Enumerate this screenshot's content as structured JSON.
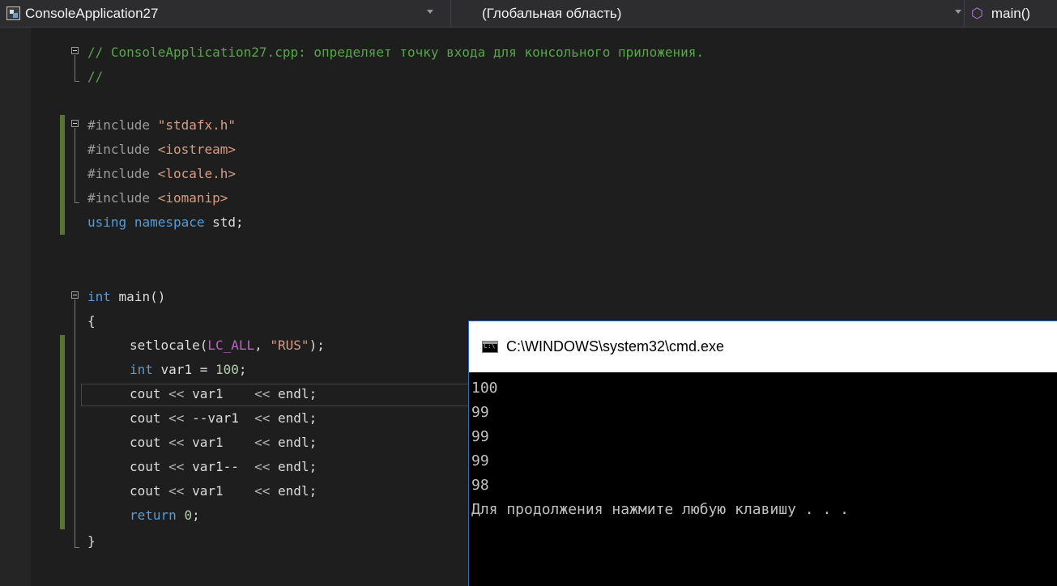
{
  "toolbar": {
    "project_name": "ConsoleApplication27",
    "scope": "(Глобальная область)",
    "member": "main()"
  },
  "icons": {
    "project": "project-icon",
    "member": "function-cube-icon",
    "console": "cmd-window-icon"
  },
  "editor": {
    "comment_line1": "// ConsoleApplication27.cpp: определяет точку входа для консольного приложения.",
    "comment_line2": "//",
    "include1_kw": "#include",
    "include1_file": "\"stdafx.h\"",
    "include2_kw": "#include",
    "include2_file": "<iostream>",
    "include3_kw": "#include",
    "include3_file": "<locale.h>",
    "include4_kw": "#include",
    "include4_file": "<iomanip>",
    "using_kw": "using",
    "namespace_kw": "namespace",
    "using_rest": "std;",
    "main_kw": "int",
    "main_rest": "main()",
    "brace_open": "{",
    "setlocale_fn": "setlocale(",
    "setlocale_macro": "LC_ALL",
    "setlocale_sep": ", ",
    "setlocale_str": "\"RUS\"",
    "setlocale_end": ");",
    "var_kw": "int",
    "var_name": " var1 = ",
    "var_val": "100",
    "var_end": ";",
    "cout1_a": "cout ",
    "cout1_op": "<<",
    "cout1_b": " var1    ",
    "cout1_op2": "<<",
    "cout1_c": " endl;",
    "cout2_a": "cout ",
    "cout2_op": "<<",
    "cout2_b": " --var1  ",
    "cout2_op2": "<<",
    "cout2_c": " endl;",
    "cout3_a": "cout ",
    "cout3_op": "<<",
    "cout3_b": " var1    ",
    "cout3_op2": "<<",
    "cout3_c": " endl;",
    "cout4_a": "cout ",
    "cout4_op": "<<",
    "cout4_b": " var1--  ",
    "cout4_op2": "<<",
    "cout4_c": " endl;",
    "cout5_a": "cout ",
    "cout5_op": "<<",
    "cout5_b": " var1    ",
    "cout5_op2": "<<",
    "cout5_c": " endl;",
    "return_kw": "return",
    "return_val": "0",
    "return_end": ";",
    "brace_close": "}"
  },
  "console": {
    "title": "C:\\WINDOWS\\system32\\cmd.exe",
    "icon_text": "C:\\",
    "output": [
      "100",
      "99",
      "99",
      "99",
      "98",
      "Для продолжения нажмите любую клавишу . . ."
    ]
  },
  "colors": {
    "editor_bg": "#1e1e1e",
    "comment": "#57a64a",
    "keyword": "#569cd6",
    "string": "#d69d85",
    "number": "#b5cea8",
    "macro": "#bd63c5",
    "change_bar": "#577430",
    "console_bg": "#000000",
    "console_text": "#c0c0c0"
  }
}
